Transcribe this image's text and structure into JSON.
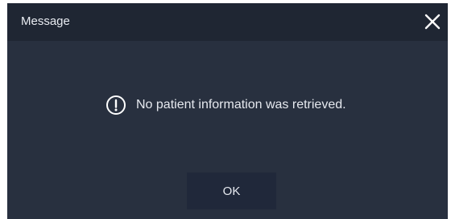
{
  "dialog": {
    "title": "Message",
    "message": "No patient information was retrieved.",
    "ok_label": "OK",
    "close_icon": "close-icon",
    "message_icon": "info-exclamation-icon"
  },
  "colors": {
    "body_background": "#28303f",
    "titlebar_background": "#1f2633",
    "button_background": "#20283a",
    "text": "#e6e9ef"
  }
}
